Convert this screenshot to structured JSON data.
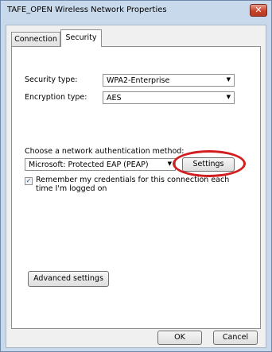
{
  "window": {
    "title": "TAFE_OPEN Wireless Network Properties",
    "close_glyph": "✕"
  },
  "tabs": [
    {
      "label": "Connection",
      "active": false
    },
    {
      "label": "Security",
      "active": true
    }
  ],
  "security": {
    "security_type_label": "Security type:",
    "security_type_value": "WPA2-Enterprise",
    "encryption_type_label": "Encryption type:",
    "encryption_type_value": "AES",
    "auth_method_label": "Choose a network authentication method:",
    "auth_method_value": "Microsoft: Protected EAP (PEAP)",
    "settings_button": "Settings",
    "remember_checked": true,
    "remember_line1": "Remember my credentials for this connection each",
    "remember_line2": "time I'm logged on",
    "advanced_button": "Advanced settings"
  },
  "footer": {
    "ok_button": "OK",
    "cancel_button": "Cancel"
  },
  "annotation": {
    "highlight_color": "#d21e1e",
    "highlight_target": "settings-button"
  },
  "glyphs": {
    "dropdown_arrow": "▼",
    "checkmark": "✓"
  }
}
